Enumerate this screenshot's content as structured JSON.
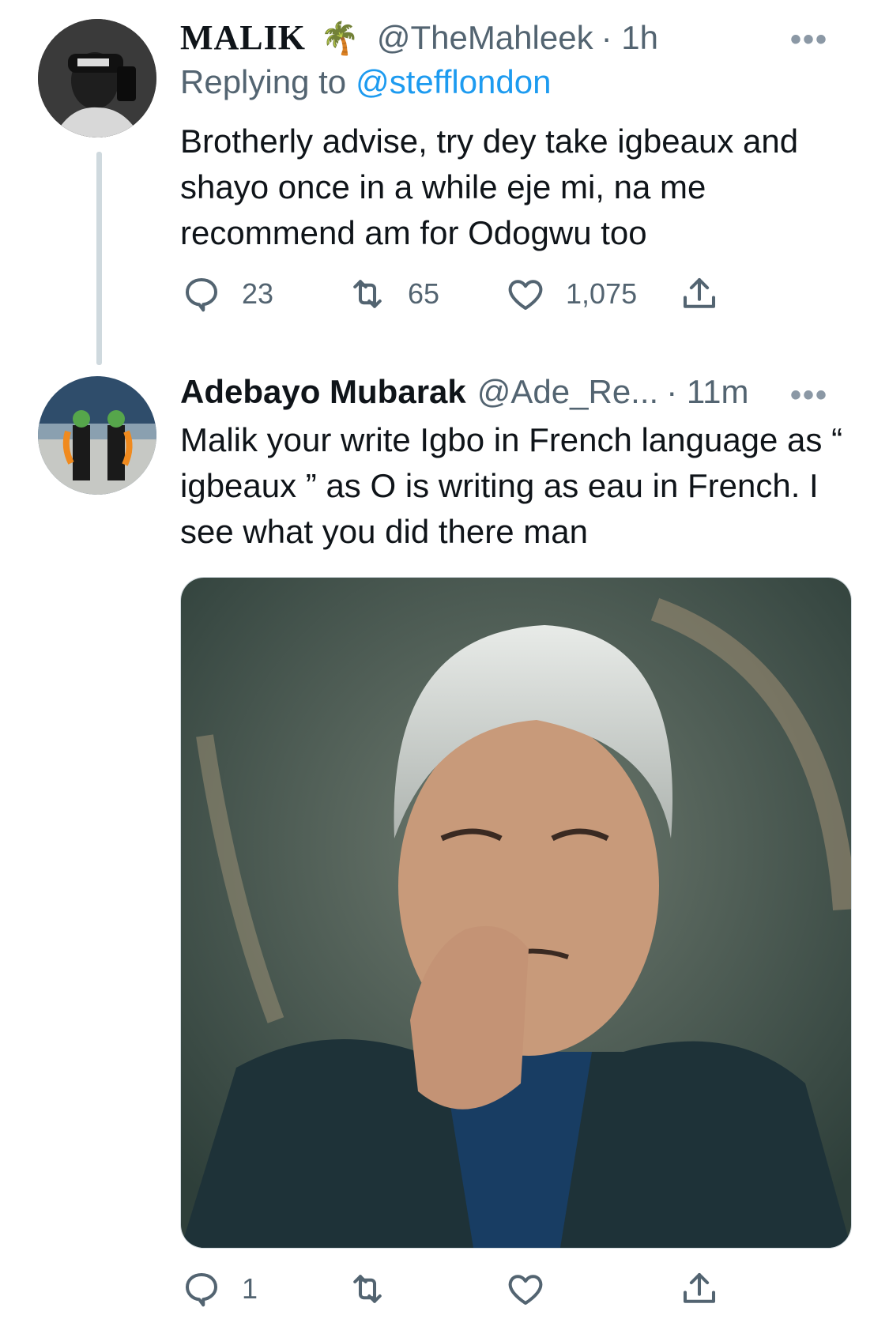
{
  "tweet1": {
    "display_name": "MALIK",
    "emoji": "🌴",
    "handle": "@TheMahleek",
    "time": "· 1h",
    "replying_prefix": "Replying to",
    "replying_to": "@stefflondon",
    "text": "Brotherly advise, try dey take igbeaux and shayo once in a while eje mi, na me recommend am for Odogwu too",
    "reply_count": "23",
    "retweet_count": "65",
    "like_count": "1,075",
    "more": "•••"
  },
  "tweet2": {
    "display_name": "Adebayo Mubarak",
    "handle": "@Ade_Re...",
    "time": "· 11m",
    "text": "Malik your write Igbo in French language as “ igbeaux ” as O is writing as eau in French. I see what you did there man",
    "reply_count": "1",
    "retweet_count": "",
    "like_count": "",
    "more": "•••"
  },
  "colors": {
    "text": "#0f1419",
    "muted": "#536471",
    "link": "#1d9bf0",
    "thread_line": "#cfd9de"
  }
}
